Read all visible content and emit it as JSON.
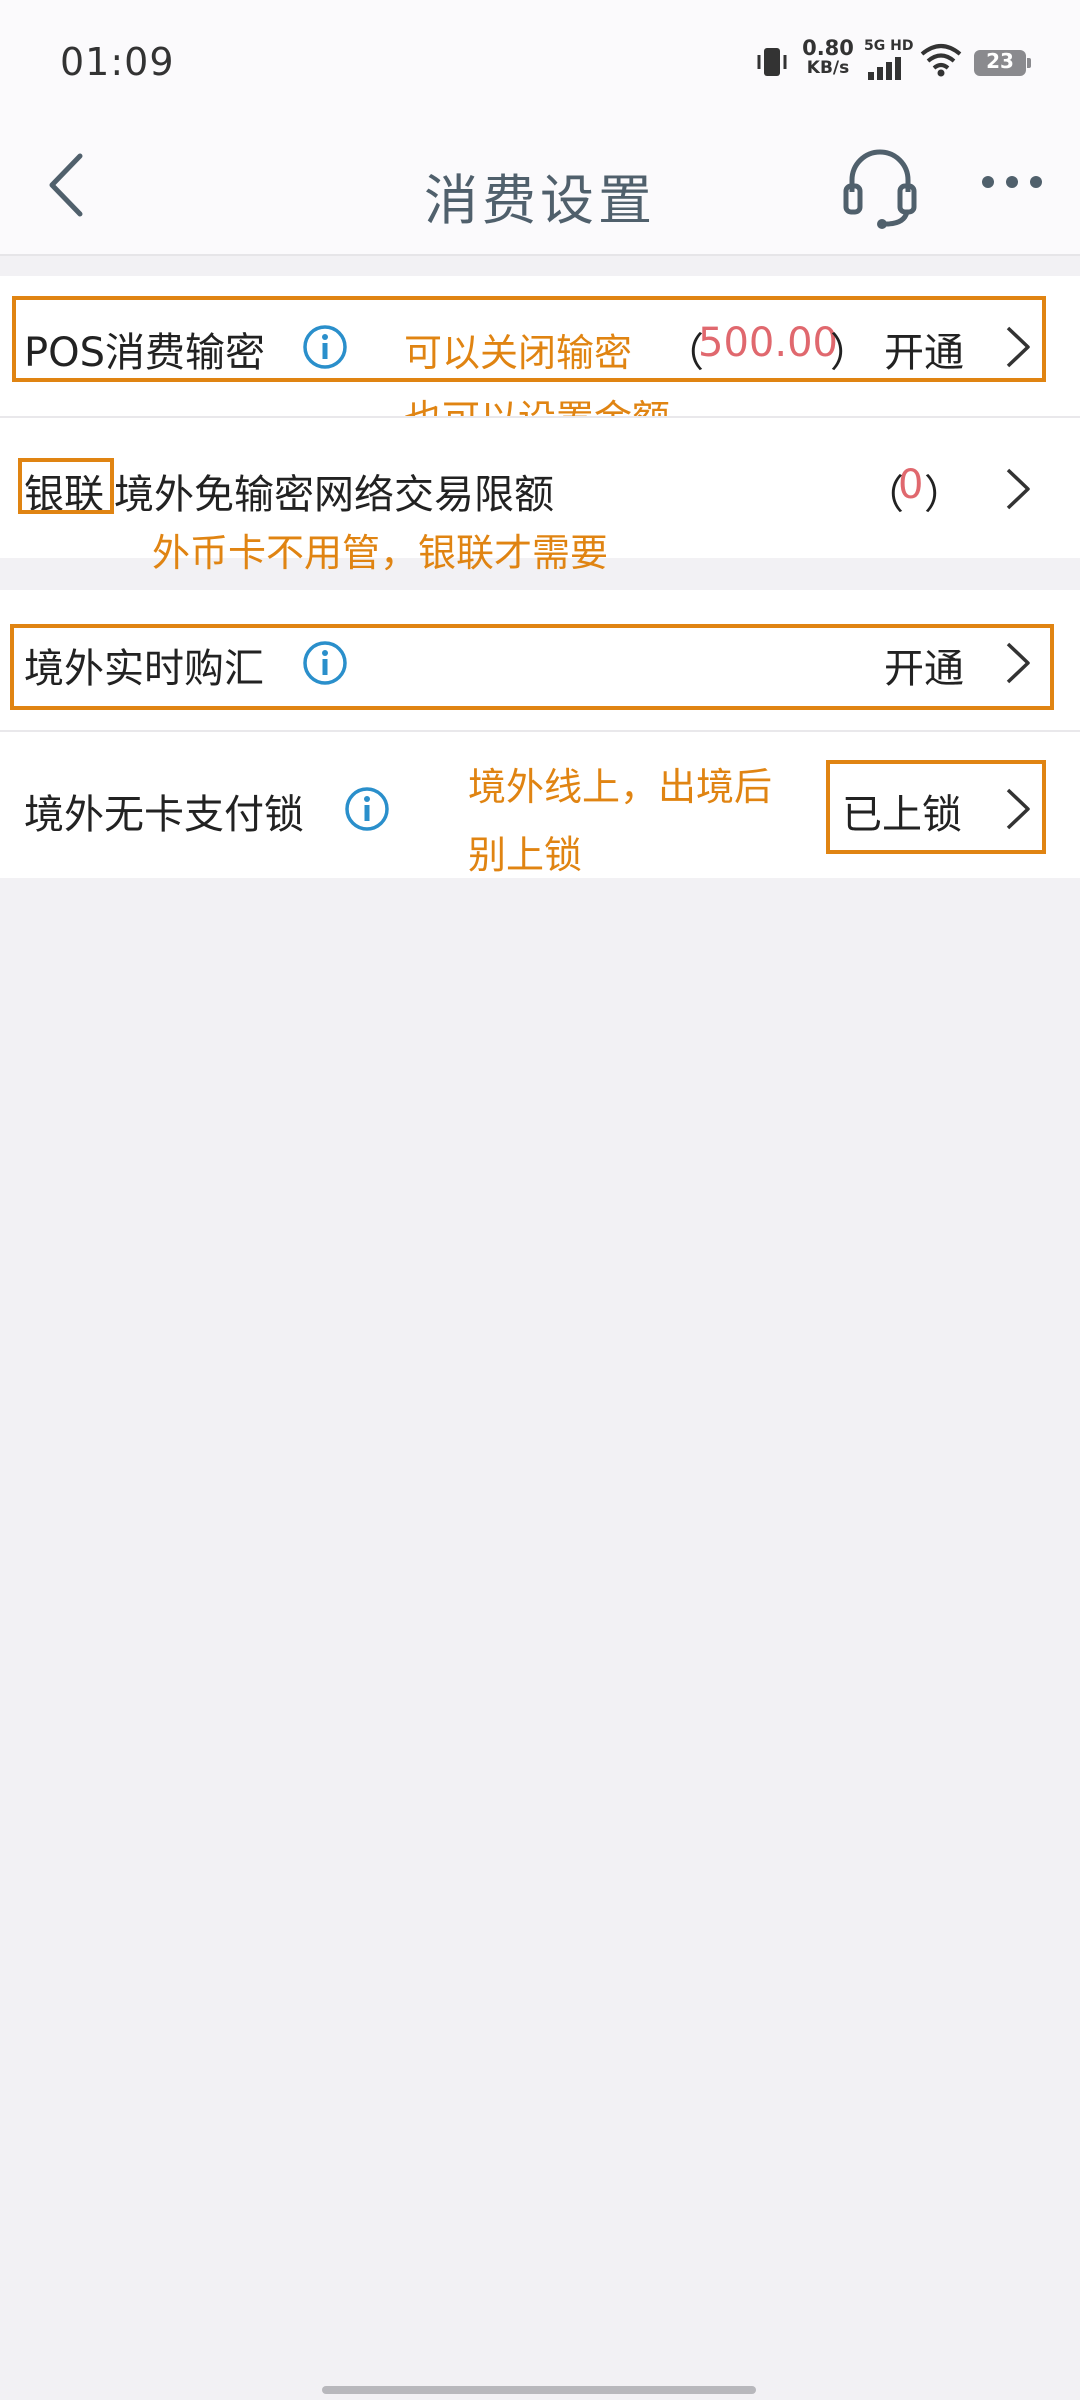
{
  "status_bar": {
    "time": "01:09",
    "net_speed_value": "0.80",
    "net_speed_unit": "KB/s",
    "network": "5G HD",
    "battery": "23"
  },
  "header": {
    "title": "消费设置",
    "back_icon": "chevron-left-icon",
    "service_icon": "headset-icon",
    "more_icon": "more-dots-icon"
  },
  "settings": {
    "pos": {
      "label": "POS消费输密",
      "note": "可以关闭输密",
      "paren_open": "（",
      "amount": "500.00",
      "paren_close": "）",
      "status": "开通",
      "note2": "也可以设置金额"
    },
    "unionpay": {
      "label_boxed": "银联",
      "label_rest": "境外免输密网络交易限额",
      "paren_open": "（",
      "amount": "0",
      "paren_close": "）",
      "note": "外币卡不用管，银联才需要"
    },
    "fx": {
      "label": "境外实时购汇",
      "status": "开通"
    },
    "cardless": {
      "label": "境外无卡支付锁",
      "note_line1": "境外线上，出境后",
      "note_line2": "别上锁",
      "status": "已上锁"
    }
  },
  "colors": {
    "annotation": "#e08412",
    "amount_red": "#e0686e",
    "info_blue": "#2a8fcb",
    "title": "#50606c"
  }
}
